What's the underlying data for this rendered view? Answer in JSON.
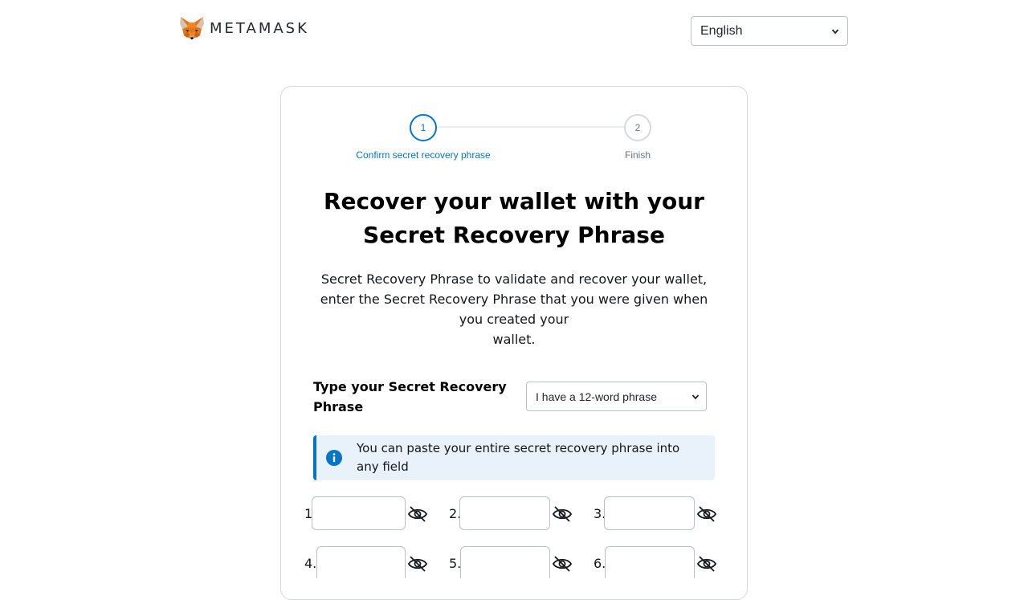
{
  "header": {
    "brand": "METAMASK",
    "logo_icon": "metamask-fox-icon",
    "language": {
      "selected": "English"
    }
  },
  "stepper": {
    "steps": [
      {
        "number": "1",
        "label": "Confirm secret recovery phrase",
        "state": "active"
      },
      {
        "number": "2",
        "label": "Finish",
        "state": "inactive"
      }
    ]
  },
  "main": {
    "title_line1": "Recover your wallet with your",
    "title_line2": "Secret Recovery Phrase",
    "description_lines": [
      "Secret Recovery Phrase to validate and recover your wallet,",
      "enter the Secret Recovery Phrase that you were given when",
      "you created your",
      "wallet."
    ],
    "type_label": "Type your Secret Recovery Phrase",
    "phrase_select": {
      "selected": "I have a 12-word phrase"
    },
    "info_banner": {
      "icon": "info-icon",
      "text": "You can paste your entire secret recovery phrase into any field"
    },
    "word_fields": [
      {
        "label": "1.",
        "value": ""
      },
      {
        "label": "2.",
        "value": ""
      },
      {
        "label": "3.",
        "value": ""
      },
      {
        "label": "4.",
        "value": ""
      },
      {
        "label": "5.",
        "value": ""
      },
      {
        "label": "6.",
        "value": ""
      }
    ]
  },
  "colors": {
    "accent": "#0376c9",
    "banner_bg": "#e9f1fa",
    "border": "#bbc0c5",
    "muted": "#6a737d"
  }
}
